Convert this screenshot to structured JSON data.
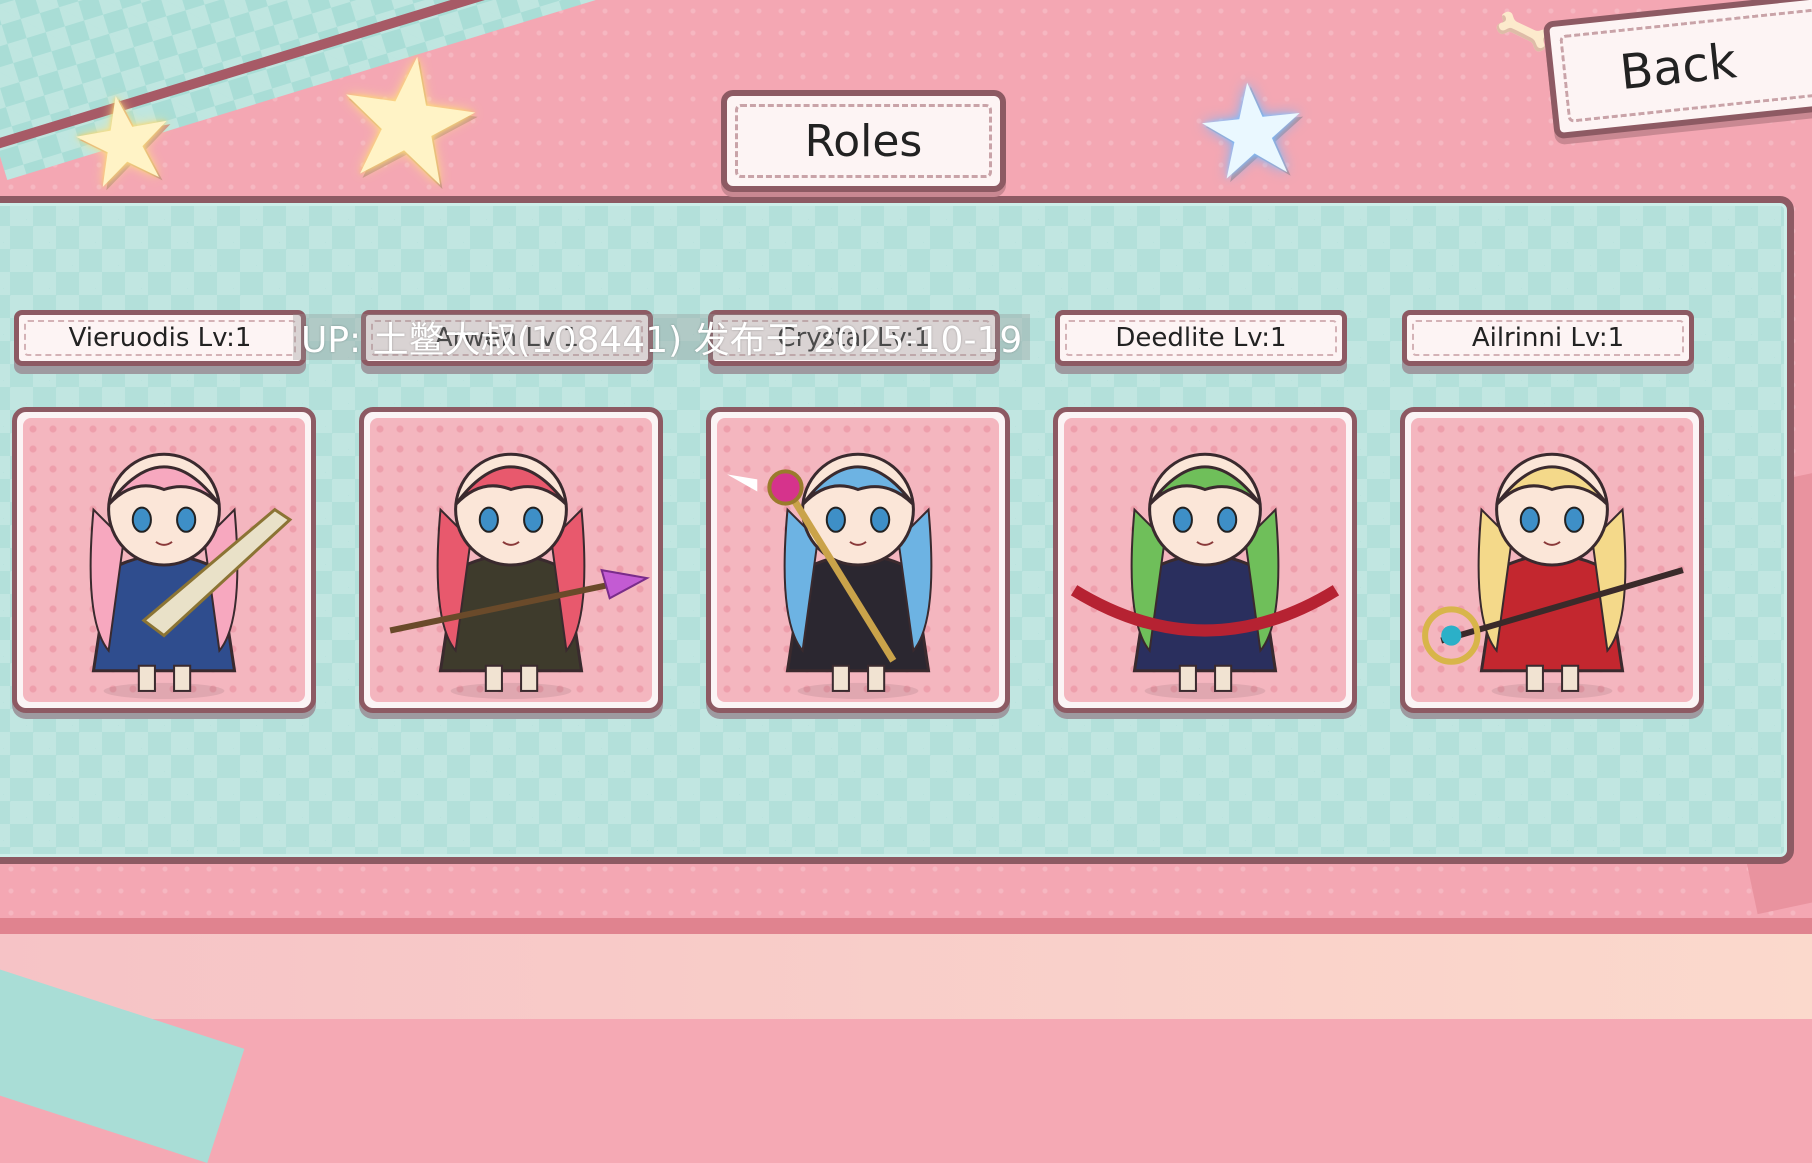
{
  "screen": {
    "title": "Roles",
    "back_label": "Back"
  },
  "roles": [
    {
      "name": "Vieruodis",
      "level": "Lv:1",
      "label": "Vieruodis  Lv:1",
      "hair": "#f7a8bf",
      "dress": "#2f4d8e",
      "weapon": "sword"
    },
    {
      "name": "Arwen",
      "level": "Lv:1",
      "label": "Arwen  Lv:1",
      "hair": "#e8596d",
      "dress": "#3e3b2c",
      "weapon": "spear"
    },
    {
      "name": "Crystal",
      "level": "Lv:1",
      "label": "Crystal  Lv:1",
      "hair": "#6db3e3",
      "dress": "#2b2730",
      "weapon": "staff"
    },
    {
      "name": "Deedlite",
      "level": "Lv:1",
      "label": "Deedlite  Lv:1",
      "hair": "#6fbf5a",
      "dress": "#2a2f5e",
      "weapon": "bow"
    },
    {
      "name": "Ailrinni",
      "level": "Lv:1",
      "label": "Ailrinni  Lv:1",
      "hair": "#f4d98a",
      "dress": "#c3272f",
      "weapon": "lance"
    }
  ],
  "watermark": "UP: 土鳖大叔(108441) 发布于 2025-10-19",
  "icons": {
    "stars": [
      "star-icon",
      "star-icon",
      "star-icon"
    ],
    "back_decoration": "bone-icon"
  },
  "colors": {
    "background_pink": "#f4a7b3",
    "panel_teal": "#b3e0da",
    "border_brown": "#8d5a63",
    "label_bg": "#fdf4f4"
  }
}
